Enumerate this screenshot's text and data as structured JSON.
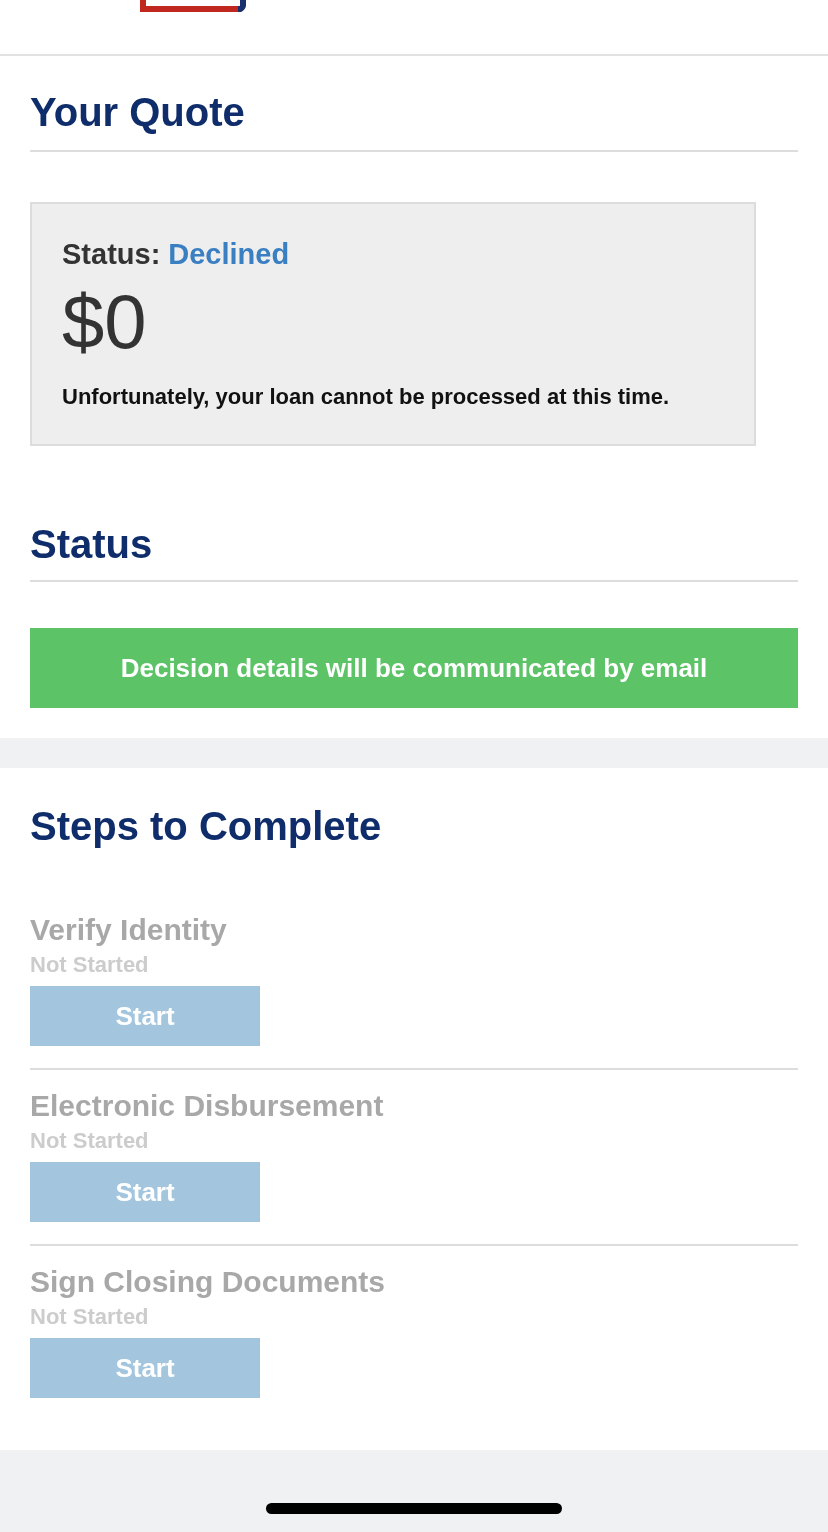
{
  "quote": {
    "title": "Your Quote",
    "status_label": "Status:",
    "status_value": "Declined",
    "amount": "$0",
    "message": "Unfortunately, your loan cannot be processed at this time."
  },
  "status": {
    "title": "Status",
    "banner": "Decision details will be communicated by email"
  },
  "steps": {
    "title": "Steps to Complete",
    "items": [
      {
        "name": "Verify Identity",
        "status": "Not Started",
        "button": "Start",
        "disabled": true
      },
      {
        "name": "Electronic Disbursement",
        "status": "Not Started",
        "button": "Start",
        "disabled": true
      },
      {
        "name": "Sign Closing Documents",
        "status": "Not Started",
        "button": "Start",
        "disabled": true
      }
    ]
  }
}
